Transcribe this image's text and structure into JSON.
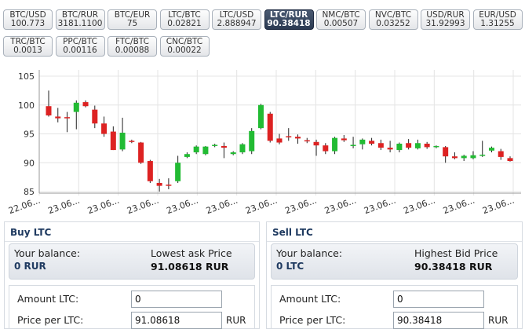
{
  "pairs": [
    {
      "name": "BTC/USD",
      "price": "100.773",
      "active": false
    },
    {
      "name": "BTC/RUR",
      "price": "3181.1100",
      "active": false
    },
    {
      "name": "BTC/EUR",
      "price": "75",
      "active": false
    },
    {
      "name": "LTC/BTC",
      "price": "0.02821",
      "active": false
    },
    {
      "name": "LTC/USD",
      "price": "2.888947",
      "active": false
    },
    {
      "name": "LTC/RUR",
      "price": "90.38418",
      "active": true
    },
    {
      "name": "NMC/BTC",
      "price": "0.00507",
      "active": false
    },
    {
      "name": "NVC/BTC",
      "price": "0.03252",
      "active": false
    },
    {
      "name": "USD/RUR",
      "price": "31.92993",
      "active": false
    },
    {
      "name": "EUR/USD",
      "price": "1.31255",
      "active": false
    },
    {
      "name": "TRC/BTC",
      "price": "0.0013",
      "active": false
    },
    {
      "name": "PPC/BTC",
      "price": "0.00116",
      "active": false
    },
    {
      "name": "FTC/BTC",
      "price": "0.00088",
      "active": false
    },
    {
      "name": "CNC/BTC",
      "price": "0.00022",
      "active": false
    }
  ],
  "chart_data": {
    "type": "candlestick",
    "ylim": [
      85,
      105
    ],
    "yticks": [
      85,
      90,
      95,
      100,
      105
    ],
    "xticks": [
      "22.06...",
      "23.06...",
      "23.06...",
      "23.06...",
      "23.06...",
      "23.06...",
      "23.06...",
      "23.06...",
      "23.06...",
      "23.06...",
      "23.06...",
      "23.06...",
      "23.06..."
    ],
    "grid": true,
    "colors": {
      "up": "#22bb33",
      "down": "#dd2222"
    },
    "candles": [
      {
        "open": 99.8,
        "close": 98.2,
        "high": 102.5,
        "low": 98.0
      },
      {
        "open": 98.0,
        "close": 97.7,
        "high": 99.5,
        "low": 97.0
      },
      {
        "open": 97.9,
        "close": 97.8,
        "high": 98.8,
        "low": 95.3
      },
      {
        "open": 98.8,
        "close": 100.4,
        "high": 100.8,
        "low": 95.8
      },
      {
        "open": 100.5,
        "close": 99.8,
        "high": 100.8,
        "low": 99.6
      },
      {
        "open": 99.2,
        "close": 96.8,
        "high": 99.9,
        "low": 96.0
      },
      {
        "open": 96.8,
        "close": 95.0,
        "high": 98.0,
        "low": 94.5
      },
      {
        "open": 95.4,
        "close": 92.2,
        "high": 96.3,
        "low": 92.2
      },
      {
        "open": 92.3,
        "close": 95.2,
        "high": 97.8,
        "low": 92.0
      },
      {
        "open": 93.8,
        "close": 93.6,
        "high": 94.0,
        "low": 93.4
      },
      {
        "open": 93.5,
        "close": 90.0,
        "high": 93.6,
        "low": 89.8
      },
      {
        "open": 90.3,
        "close": 86.8,
        "high": 90.5,
        "low": 86.5
      },
      {
        "open": 86.5,
        "close": 86.0,
        "high": 87.2,
        "low": 85.0
      },
      {
        "open": 86.2,
        "close": 86.0,
        "high": 87.3,
        "low": 85.4
      },
      {
        "open": 86.8,
        "close": 90.0,
        "high": 91.2,
        "low": 86.5
      },
      {
        "open": 91.0,
        "close": 91.5,
        "high": 91.8,
        "low": 90.8
      },
      {
        "open": 91.8,
        "close": 92.8,
        "high": 93.0,
        "low": 91.5
      },
      {
        "open": 91.5,
        "close": 92.8,
        "high": 92.9,
        "low": 91.3
      },
      {
        "open": 92.9,
        "close": 93.1,
        "high": 93.3,
        "low": 92.7
      },
      {
        "open": 92.9,
        "close": 92.6,
        "high": 93.5,
        "low": 90.8
      },
      {
        "open": 91.5,
        "close": 91.8,
        "high": 92.0,
        "low": 91.3
      },
      {
        "open": 91.8,
        "close": 93.2,
        "high": 93.4,
        "low": 91.5
      },
      {
        "open": 92.0,
        "close": 95.5,
        "high": 96.0,
        "low": 91.5
      },
      {
        "open": 96.0,
        "close": 100.0,
        "high": 100.2,
        "low": 95.8
      },
      {
        "open": 98.5,
        "close": 93.8,
        "high": 98.8,
        "low": 93.5
      },
      {
        "open": 94.2,
        "close": 93.5,
        "high": 95.0,
        "low": 93.2
      },
      {
        "open": 94.6,
        "close": 94.5,
        "high": 96.0,
        "low": 93.8
      },
      {
        "open": 94.5,
        "close": 94.2,
        "high": 94.9,
        "low": 93.3
      },
      {
        "open": 93.9,
        "close": 93.7,
        "high": 94.3,
        "low": 93.4
      },
      {
        "open": 93.6,
        "close": 93.0,
        "high": 94.0,
        "low": 91.2
      },
      {
        "open": 93.0,
        "close": 92.0,
        "high": 93.4,
        "low": 91.5
      },
      {
        "open": 92.0,
        "close": 94.3,
        "high": 94.5,
        "low": 91.5
      },
      {
        "open": 94.2,
        "close": 93.9,
        "high": 94.8,
        "low": 93.6
      },
      {
        "open": 93.0,
        "close": 93.1,
        "high": 94.5,
        "low": 92.5
      },
      {
        "open": 93.2,
        "close": 94.0,
        "high": 94.2,
        "low": 92.3
      },
      {
        "open": 93.8,
        "close": 93.3,
        "high": 94.3,
        "low": 93.0
      },
      {
        "open": 93.4,
        "close": 92.6,
        "high": 94.0,
        "low": 92.2
      },
      {
        "open": 92.6,
        "close": 92.3,
        "high": 93.8,
        "low": 91.8
      },
      {
        "open": 92.2,
        "close": 93.3,
        "high": 93.5,
        "low": 91.8
      },
      {
        "open": 93.4,
        "close": 92.6,
        "high": 94.1,
        "low": 92.3
      },
      {
        "open": 92.5,
        "close": 93.4,
        "high": 94.0,
        "low": 92.3
      },
      {
        "open": 93.3,
        "close": 92.7,
        "high": 93.6,
        "low": 92.4
      },
      {
        "open": 92.7,
        "close": 92.9,
        "high": 93.0,
        "low": 92.5
      },
      {
        "open": 92.7,
        "close": 91.1,
        "high": 92.9,
        "low": 90.0
      },
      {
        "open": 91.1,
        "close": 90.8,
        "high": 91.8,
        "low": 90.6
      },
      {
        "open": 90.8,
        "close": 91.2,
        "high": 91.4,
        "low": 90.3
      },
      {
        "open": 90.8,
        "close": 91.3,
        "high": 92.0,
        "low": 90.6
      },
      {
        "open": 91.3,
        "close": 91.4,
        "high": 93.8,
        "low": 91.0
      },
      {
        "open": 92.1,
        "close": 92.6,
        "high": 92.8,
        "low": 91.8
      },
      {
        "open": 92.0,
        "close": 91.0,
        "high": 92.4,
        "low": 90.5
      },
      {
        "open": 90.8,
        "close": 90.3,
        "high": 91.1,
        "low": 90.2
      }
    ]
  },
  "buy": {
    "title": "Buy LTC",
    "balance_label": "Your balance:",
    "balance_value": "0 RUR",
    "price_label": "Lowest ask Price",
    "price_value": "91.08618 RUR",
    "amount_label": "Amount LTC:",
    "amount_value": "0",
    "price_per_label": "Price per LTC:",
    "price_per_value": "91.08618",
    "unit": "RUR"
  },
  "sell": {
    "title": "Sell LTC",
    "balance_label": "Your balance:",
    "balance_value": "0 LTC",
    "price_label": "Highest Bid Price",
    "price_value": "90.38418 RUR",
    "amount_label": "Amount LTC:",
    "amount_value": "0",
    "price_per_label": "Price per LTC:",
    "price_per_value": "90.38418",
    "unit": "RUR"
  }
}
